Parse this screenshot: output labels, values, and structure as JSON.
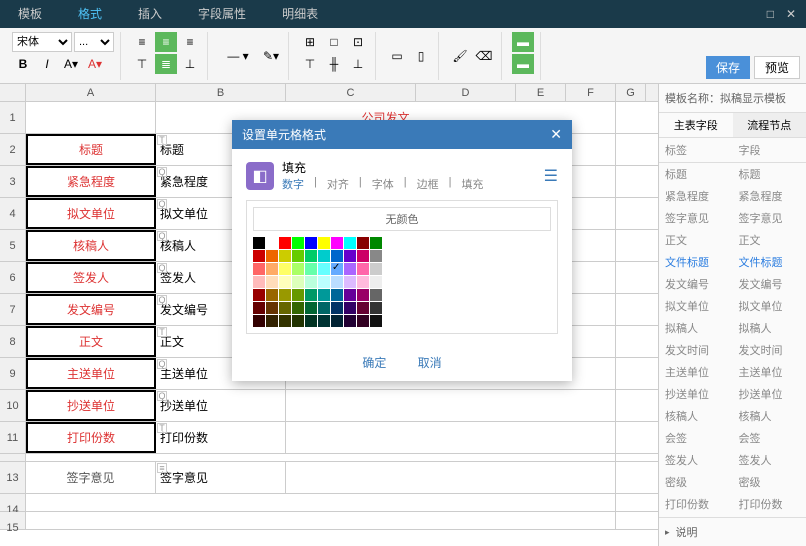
{
  "menu": {
    "tpl": "模板",
    "fmt": "格式",
    "ins": "插入",
    "fld": "字段属性",
    "det": "明细表"
  },
  "toolbar": {
    "font": "宋体",
    "size": "...",
    "save": "保存",
    "preview": "预览"
  },
  "doc_title": "公司发文",
  "rows": [
    {
      "a": "标题",
      "b": "标题"
    },
    {
      "a": "紧急程度",
      "b": "紧急程度"
    },
    {
      "a": "拟文单位",
      "b": "拟文单位"
    },
    {
      "a": "核稿人",
      "b": "核稿人"
    },
    {
      "a": "签发人",
      "b": "签发人"
    },
    {
      "a": "发文编号",
      "b": "发文编号"
    },
    {
      "a": "正文",
      "b": "正文"
    },
    {
      "a": "主送单位",
      "b": "主送单位"
    },
    {
      "a": "抄送单位",
      "b": "抄送单位"
    },
    {
      "a": "打印份数",
      "b": "打印份数"
    }
  ],
  "sig": "签字意见",
  "sig2": "签字意见",
  "right": {
    "tplname_lbl": "模板名称：",
    "tplname": "拟稿显示模板",
    "tab1": "主表字段",
    "tab2": "流程节点",
    "col1": "标签",
    "col2": "字段",
    "fields": [
      {
        "a": "标题",
        "b": "标题"
      },
      {
        "a": "紧急程度",
        "b": "紧急程度"
      },
      {
        "a": "签字意见",
        "b": "签字意见"
      },
      {
        "a": "正文",
        "b": "正文"
      },
      {
        "a": "文件标题",
        "b": "文件标题",
        "hl": true
      },
      {
        "a": "发文编号",
        "b": "发文编号"
      },
      {
        "a": "拟文单位",
        "b": "拟文单位"
      },
      {
        "a": "拟稿人",
        "b": "拟稿人"
      },
      {
        "a": "发文时间",
        "b": "发文时间"
      },
      {
        "a": "主送单位",
        "b": "主送单位"
      },
      {
        "a": "抄送单位",
        "b": "抄送单位"
      },
      {
        "a": "核稿人",
        "b": "核稿人"
      },
      {
        "a": "会签",
        "b": "会签"
      },
      {
        "a": "签发人",
        "b": "签发人"
      },
      {
        "a": "密级",
        "b": "密级"
      },
      {
        "a": "打印份数",
        "b": "打印份数"
      }
    ],
    "desc": "说明"
  },
  "dialog": {
    "title": "设置单元格格式",
    "cat": "填充",
    "tabs": {
      "num": "数字",
      "align": "对齐",
      "font": "字体",
      "border": "边框",
      "fill": "填充"
    },
    "nocolor": "无颜色",
    "ok": "确定",
    "cancel": "取消"
  },
  "cols": [
    "",
    "A",
    "B",
    "C",
    "D",
    "E",
    "F",
    "G"
  ],
  "palette": [
    [
      "#000",
      "#fff",
      "#f00",
      "#0f0",
      "#00f",
      "#ff0",
      "#f0f",
      "#0ff",
      "#800",
      "#080"
    ],
    [
      "#c00",
      "#e60",
      "#cc0",
      "#6c0",
      "#0c6",
      "#0cc",
      "#06c",
      "#60c",
      "#c06",
      "#888"
    ],
    [
      "#f66",
      "#fa6",
      "#ff6",
      "#af6",
      "#6fa",
      "#6ff",
      "#6af",
      "#a6f",
      "#f6a",
      "#ccc"
    ],
    [
      "#fbb",
      "#fdb",
      "#ffb",
      "#dfb",
      "#bfd",
      "#bff",
      "#bdf",
      "#dbf",
      "#fbd",
      "#eee"
    ],
    [
      "#900",
      "#960",
      "#990",
      "#690",
      "#096",
      "#099",
      "#069",
      "#609",
      "#906",
      "#666"
    ],
    [
      "#600",
      "#630",
      "#660",
      "#360",
      "#063",
      "#066",
      "#036",
      "#306",
      "#603",
      "#333"
    ],
    [
      "#300",
      "#320",
      "#330",
      "#230",
      "#032",
      "#033",
      "#023",
      "#203",
      "#302",
      "#111"
    ]
  ]
}
